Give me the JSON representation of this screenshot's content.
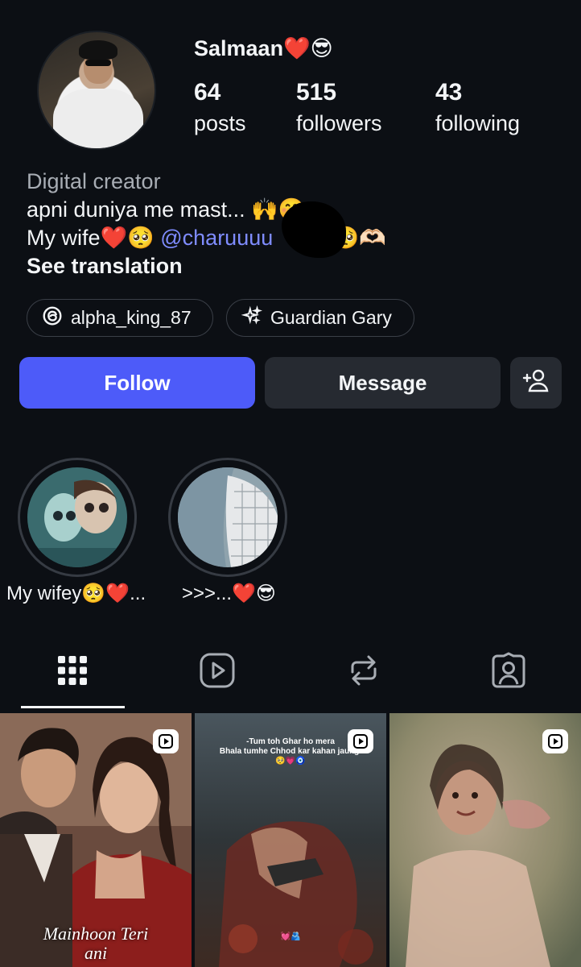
{
  "profile": {
    "username": "Salmaan❤️😎",
    "stats": [
      {
        "num": "64",
        "label": "posts"
      },
      {
        "num": "515",
        "label": "followers"
      },
      {
        "num": "43",
        "label": "following"
      }
    ],
    "bio": {
      "category": "Digital creator",
      "line1": "apni duniya me mast... 🙌🤭",
      "line2_prefix": "My wife❤️🥺 ",
      "mention": "@charuuuu",
      "line2_suffix": "  🥺🫶🏻",
      "see_translation": "See translation"
    },
    "chips": [
      {
        "icon": "threads-icon",
        "label": "alpha_king_87"
      },
      {
        "icon": "sparkle-icon",
        "label": "Guardian Gary"
      }
    ]
  },
  "actions": {
    "follow": "Follow",
    "message": "Message",
    "add_user_icon": "add-person-icon"
  },
  "highlights": [
    {
      "label": "My wifey🥺❤️..."
    },
    {
      "label": ">>>...❤️😎"
    }
  ],
  "tabs": [
    "grid-icon",
    "reels-icon",
    "reposts-icon",
    "tagged-icon"
  ],
  "posts": [
    {
      "type": "reel",
      "caption": "Mainhoon Teri\nani"
    },
    {
      "type": "reel",
      "caption": "-Tum toh Ghar ho mera\nBhala tumhe Chhod kar kahan jaungi\n🥺💗🧿",
      "footer": "💓🫂"
    },
    {
      "type": "reel",
      "caption": ""
    }
  ],
  "colors": {
    "background": "#0c0f14",
    "accent": "#4d5bf9",
    "mention": "#7f8cff",
    "secondary_button": "#262a31"
  }
}
